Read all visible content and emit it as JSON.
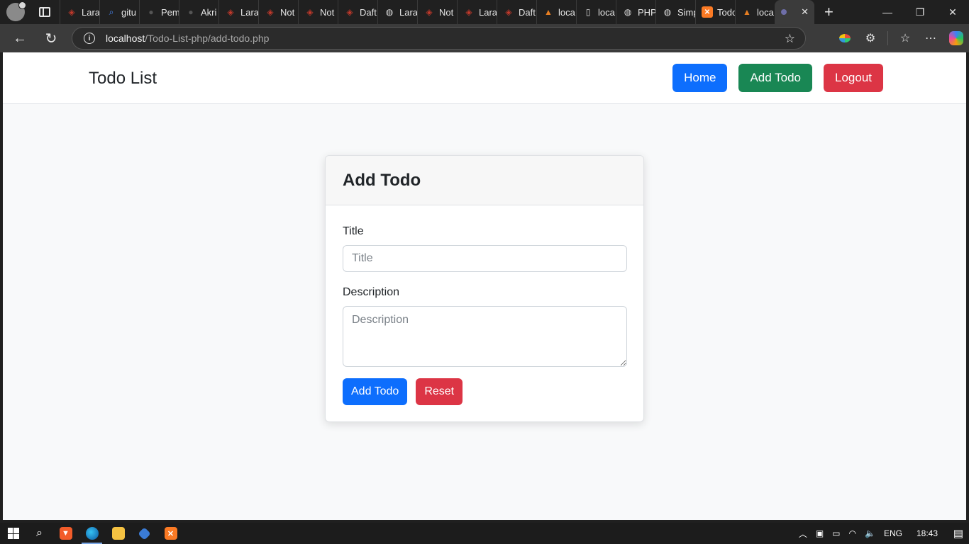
{
  "browser": {
    "tabs": [
      {
        "label": "Lara",
        "icon": "laravel-icon"
      },
      {
        "label": "gitu",
        "icon": "search-icon"
      },
      {
        "label": "Pem",
        "icon": "github-icon"
      },
      {
        "label": "Akri",
        "icon": "github-icon"
      },
      {
        "label": "Lara",
        "icon": "laravel-icon"
      },
      {
        "label": "Not",
        "icon": "laravel-icon"
      },
      {
        "label": "Not",
        "icon": "laravel-icon"
      },
      {
        "label": "Daft",
        "icon": "laravel-icon"
      },
      {
        "label": "Lara",
        "icon": "globe-icon"
      },
      {
        "label": "Not",
        "icon": "laravel-icon"
      },
      {
        "label": "Lara",
        "icon": "laravel-icon"
      },
      {
        "label": "Daft",
        "icon": "laravel-icon"
      },
      {
        "label": "loca",
        "icon": "cone-icon"
      },
      {
        "label": "loca",
        "icon": "document-icon"
      },
      {
        "label": "PHP",
        "icon": "globe-icon"
      },
      {
        "label": "Simp",
        "icon": "globe-icon"
      },
      {
        "label": "Todo",
        "icon": "xampp-icon"
      },
      {
        "label": "loca",
        "icon": "cone-icon"
      }
    ],
    "url": {
      "host": "localhost",
      "path": "/Todo-List-php/add-todo.php"
    }
  },
  "app": {
    "brand": "Todo List",
    "nav": {
      "home": "Home",
      "add_todo": "Add Todo",
      "logout": "Logout"
    },
    "card": {
      "title": "Add Todo",
      "title_label": "Title",
      "title_placeholder": "Title",
      "description_label": "Description",
      "description_placeholder": "Description",
      "submit_label": "Add Todo",
      "reset_label": "Reset"
    }
  },
  "colors": {
    "primary": "#0d6efd",
    "success": "#198754",
    "danger": "#dc3545"
  },
  "taskbar": {
    "language": "ENG",
    "time": "18:43"
  }
}
